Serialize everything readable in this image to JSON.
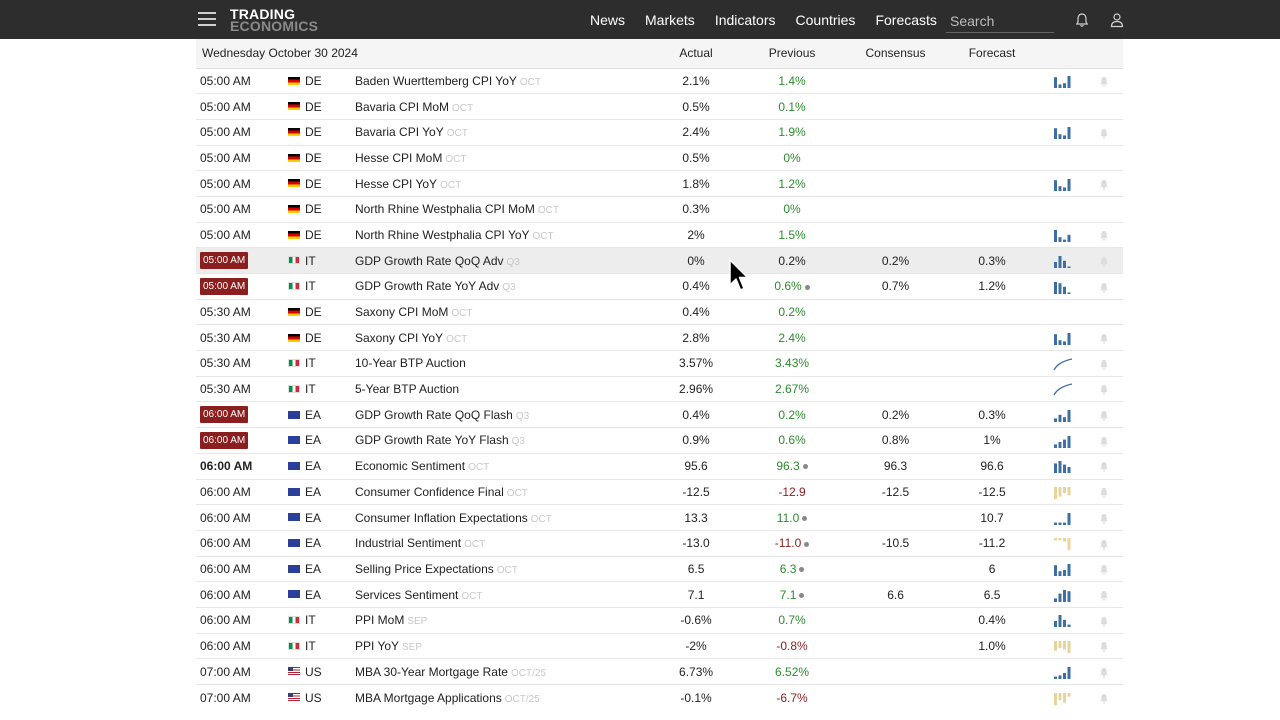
{
  "header": {
    "logo_line1": "TRADING",
    "logo_line2": "ECONOMICS",
    "nav": [
      "News",
      "Markets",
      "Indicators",
      "Countries",
      "Forecasts"
    ],
    "search_placeholder": "Search"
  },
  "table": {
    "date_header": "Wednesday October 30 2024",
    "columns": [
      "Actual",
      "Previous",
      "Consensus",
      "Forecast"
    ],
    "rows": [
      {
        "time": "05:00 AM",
        "style": "plain",
        "flag": "de",
        "country": "DE",
        "event": "Baden Wuerttemberg CPI YoY",
        "ref": "OCT",
        "actual": "2.1%",
        "previous": "1.4%",
        "prev_color": "green",
        "revised": false,
        "consensus": "",
        "forecast": "",
        "spark": "bars-blue",
        "bars": [
          0.9,
          0.3,
          0.4,
          1.0
        ]
      },
      {
        "time": "05:00 AM",
        "style": "plain",
        "flag": "de",
        "country": "DE",
        "event": "Bavaria CPI MoM",
        "ref": "OCT",
        "actual": "0.5%",
        "previous": "0.1%",
        "prev_color": "green",
        "revised": false,
        "consensus": "",
        "forecast": "",
        "spark": "none",
        "bars": []
      },
      {
        "time": "05:00 AM",
        "style": "plain",
        "flag": "de",
        "country": "DE",
        "event": "Bavaria CPI YoY",
        "ref": "OCT",
        "actual": "2.4%",
        "previous": "1.9%",
        "prev_color": "green",
        "revised": false,
        "consensus": "",
        "forecast": "",
        "spark": "bars-blue",
        "bars": [
          0.9,
          0.4,
          0.3,
          1.0
        ]
      },
      {
        "time": "05:00 AM",
        "style": "plain",
        "flag": "de",
        "country": "DE",
        "event": "Hesse CPI MoM",
        "ref": "OCT",
        "actual": "0.5%",
        "previous": "0%",
        "prev_color": "green",
        "revised": false,
        "consensus": "",
        "forecast": "",
        "spark": "none",
        "bars": []
      },
      {
        "time": "05:00 AM",
        "style": "plain",
        "flag": "de",
        "country": "DE",
        "event": "Hesse CPI YoY",
        "ref": "OCT",
        "actual": "1.8%",
        "previous": "1.2%",
        "prev_color": "green",
        "revised": false,
        "consensus": "",
        "forecast": "",
        "spark": "bars-blue",
        "bars": [
          0.9,
          0.4,
          0.3,
          1.0
        ]
      },
      {
        "time": "05:00 AM",
        "style": "plain",
        "flag": "de",
        "country": "DE",
        "event": "North Rhine Westphalia CPI MoM",
        "ref": "OCT",
        "actual": "0.3%",
        "previous": "0%",
        "prev_color": "green",
        "revised": false,
        "consensus": "",
        "forecast": "",
        "spark": "none",
        "bars": []
      },
      {
        "time": "05:00 AM",
        "style": "plain",
        "flag": "de",
        "country": "DE",
        "event": "North Rhine Westphalia CPI YoY",
        "ref": "OCT",
        "actual": "2%",
        "previous": "1.5%",
        "prev_color": "green",
        "revised": false,
        "consensus": "",
        "forecast": "",
        "spark": "bars-blue",
        "bars": [
          1.0,
          0.4,
          0.2,
          0.6
        ]
      },
      {
        "time": "05:00 AM",
        "style": "badge",
        "flag": "it",
        "country": "IT",
        "event": "GDP Growth Rate QoQ Adv",
        "ref": "Q3",
        "actual": "0%",
        "previous": "0.2%",
        "prev_color": "plain",
        "revised": false,
        "consensus": "0.2%",
        "forecast": "0.3%",
        "spark": "bars-blue",
        "bars": [
          0.5,
          1.0,
          0.6,
          0.0
        ]
      },
      {
        "time": "05:00 AM",
        "style": "badge",
        "flag": "it",
        "country": "IT",
        "event": "GDP Growth Rate YoY Adv",
        "ref": "Q3",
        "actual": "0.4%",
        "previous": "0.6%",
        "prev_color": "green",
        "revised": true,
        "consensus": "0.7%",
        "forecast": "1.2%",
        "spark": "bars-blue",
        "bars": [
          1.0,
          0.9,
          0.6,
          0.1
        ]
      },
      {
        "time": "05:30 AM",
        "style": "plain",
        "flag": "de",
        "country": "DE",
        "event": "Saxony CPI MoM",
        "ref": "OCT",
        "actual": "0.4%",
        "previous": "0.2%",
        "prev_color": "green",
        "revised": false,
        "consensus": "",
        "forecast": "",
        "spark": "none",
        "bars": []
      },
      {
        "time": "05:30 AM",
        "style": "plain",
        "flag": "de",
        "country": "DE",
        "event": "Saxony CPI YoY",
        "ref": "OCT",
        "actual": "2.8%",
        "previous": "2.4%",
        "prev_color": "green",
        "revised": false,
        "consensus": "",
        "forecast": "",
        "spark": "bars-blue",
        "bars": [
          0.9,
          0.4,
          0.3,
          1.0
        ]
      },
      {
        "time": "05:30 AM",
        "style": "plain",
        "flag": "it",
        "country": "IT",
        "event": "10-Year BTP Auction",
        "ref": "",
        "actual": "3.57%",
        "previous": "3.43%",
        "prev_color": "green",
        "revised": false,
        "consensus": "",
        "forecast": "",
        "spark": "curve-blue",
        "bars": []
      },
      {
        "time": "05:30 AM",
        "style": "plain",
        "flag": "it",
        "country": "IT",
        "event": "5-Year BTP Auction",
        "ref": "",
        "actual": "2.96%",
        "previous": "2.67%",
        "prev_color": "green",
        "revised": false,
        "consensus": "",
        "forecast": "",
        "spark": "curve-blue",
        "bars": []
      },
      {
        "time": "06:00 AM",
        "style": "badge",
        "flag": "ea",
        "country": "EA",
        "event": "GDP Growth Rate QoQ Flash",
        "ref": "Q3",
        "actual": "0.4%",
        "previous": "0.2%",
        "prev_color": "green",
        "revised": false,
        "consensus": "0.2%",
        "forecast": "0.3%",
        "spark": "bars-blue",
        "bars": [
          0.3,
          0.6,
          0.4,
          1.0
        ]
      },
      {
        "time": "06:00 AM",
        "style": "badge",
        "flag": "ea",
        "country": "EA",
        "event": "GDP Growth Rate YoY Flash",
        "ref": "Q3",
        "actual": "0.9%",
        "previous": "0.6%",
        "prev_color": "green",
        "revised": false,
        "consensus": "0.8%",
        "forecast": "1%",
        "spark": "bars-blue",
        "bars": [
          0.3,
          0.5,
          0.7,
          1.0
        ]
      },
      {
        "time": "06:00 AM",
        "style": "bold",
        "flag": "ea",
        "country": "EA",
        "event": "Economic Sentiment",
        "ref": "OCT",
        "actual": "95.6",
        "previous": "96.3",
        "prev_color": "green",
        "revised": true,
        "consensus": "96.3",
        "forecast": "96.6",
        "spark": "bars-blue",
        "bars": [
          0.8,
          1.0,
          0.7,
          0.5
        ]
      },
      {
        "time": "06:00 AM",
        "style": "plain",
        "flag": "ea",
        "country": "EA",
        "event": "Consumer Confidence Final",
        "ref": "OCT",
        "actual": "-12.5",
        "previous": "-12.9",
        "prev_color": "red",
        "revised": false,
        "consensus": "-12.5",
        "forecast": "-12.5",
        "spark": "bars-yellow",
        "bars": [
          1.0,
          0.8,
          0.5,
          0.7
        ]
      },
      {
        "time": "06:00 AM",
        "style": "plain",
        "flag": "ea",
        "country": "EA",
        "event": "Consumer Inflation Expectations",
        "ref": "OCT",
        "actual": "13.3",
        "previous": "11.0",
        "prev_color": "green",
        "revised": true,
        "consensus": "",
        "forecast": "10.7",
        "spark": "bars-blue",
        "bars": [
          0.2,
          0.2,
          0.2,
          1.0
        ]
      },
      {
        "time": "06:00 AM",
        "style": "plain",
        "flag": "ea",
        "country": "EA",
        "event": "Industrial Sentiment",
        "ref": "OCT",
        "actual": "-13.0",
        "previous": "-11.0",
        "prev_color": "red",
        "revised": true,
        "consensus": "-10.5",
        "forecast": "-11.2",
        "spark": "bars-yellow",
        "bars": [
          0.2,
          0.2,
          0.3,
          1.0
        ]
      },
      {
        "time": "06:00 AM",
        "style": "plain",
        "flag": "ea",
        "country": "EA",
        "event": "Selling Price Expectations",
        "ref": "OCT",
        "actual": "6.5",
        "previous": "6.3",
        "prev_color": "green",
        "revised": true,
        "consensus": "",
        "forecast": "6",
        "spark": "bars-blue",
        "bars": [
          0.9,
          0.4,
          0.5,
          1.0
        ]
      },
      {
        "time": "06:00 AM",
        "style": "plain",
        "flag": "ea",
        "country": "EA",
        "event": "Services Sentiment",
        "ref": "OCT",
        "actual": "7.1",
        "previous": "7.1",
        "prev_color": "green",
        "revised": true,
        "consensus": "6.6",
        "forecast": "6.5",
        "spark": "bars-blue",
        "bars": [
          0.3,
          0.7,
          1.0,
          0.9
        ]
      },
      {
        "time": "06:00 AM",
        "style": "plain",
        "flag": "it",
        "country": "IT",
        "event": "PPI MoM",
        "ref": "SEP",
        "actual": "-0.6%",
        "previous": "0.7%",
        "prev_color": "green",
        "revised": false,
        "consensus": "",
        "forecast": "0.4%",
        "spark": "bars-blue",
        "bars": [
          0.5,
          1.0,
          0.6,
          0.2
        ]
      },
      {
        "time": "06:00 AM",
        "style": "plain",
        "flag": "it",
        "country": "IT",
        "event": "PPI YoY",
        "ref": "SEP",
        "actual": "-2%",
        "previous": "-0.8%",
        "prev_color": "red",
        "revised": false,
        "consensus": "",
        "forecast": "1.0%",
        "spark": "bars-yellow",
        "bars": [
          0.8,
          0.6,
          0.7,
          1.0
        ]
      },
      {
        "time": "07:00 AM",
        "style": "plain",
        "flag": "us",
        "country": "US",
        "event": "MBA 30-Year Mortgage Rate",
        "ref": "OCT/25",
        "actual": "6.73%",
        "previous": "6.52%",
        "prev_color": "green",
        "revised": false,
        "consensus": "",
        "forecast": "",
        "spark": "bars-blue",
        "bars": [
          0.2,
          0.3,
          0.5,
          1.0
        ]
      },
      {
        "time": "07:00 AM",
        "style": "plain",
        "flag": "us",
        "country": "US",
        "event": "MBA Mortgage Applications",
        "ref": "OCT/25",
        "actual": "-0.1%",
        "previous": "-6.7%",
        "prev_color": "red",
        "revised": false,
        "consensus": "",
        "forecast": "",
        "spark": "bars-yellow",
        "bars": [
          1.0,
          0.6,
          0.8,
          0.3
        ]
      }
    ]
  },
  "colors": {
    "topbar": "#2d2d2d",
    "badge": "#8b1e1e",
    "positive": "#2e8b2e",
    "negative": "#8b1e1e",
    "spark_blue": "#3d6fa5",
    "spark_yellow": "#e8d49a"
  },
  "icons": [
    "menu-icon",
    "bell-icon",
    "user-icon",
    "alert-bell-icon",
    "mouse-cursor-icon"
  ]
}
